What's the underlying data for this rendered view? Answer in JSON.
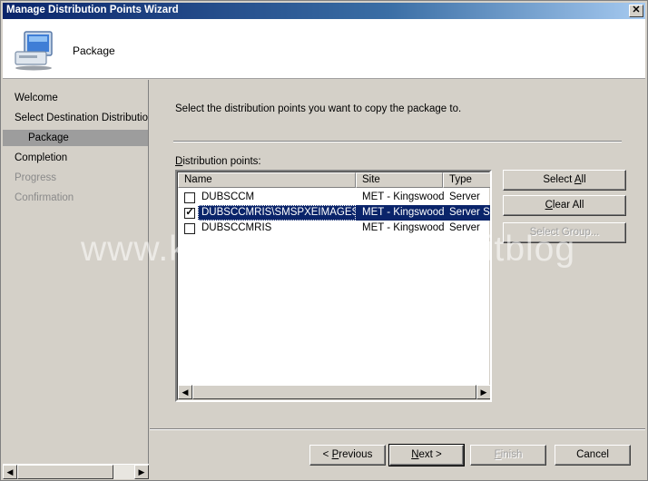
{
  "window": {
    "title": "Manage Distribution Points Wizard",
    "close_label": "✕"
  },
  "header": {
    "title": "Package",
    "icon": "computer-icon"
  },
  "sidebar": {
    "items": [
      {
        "label": "Welcome",
        "state": "normal"
      },
      {
        "label": "Select Destination Distribution P",
        "state": "normal"
      },
      {
        "label": "Package",
        "state": "active"
      },
      {
        "label": "Completion",
        "state": "normal"
      },
      {
        "label": "Progress",
        "state": "disabled"
      },
      {
        "label": "Confirmation",
        "state": "disabled"
      }
    ],
    "scroll_left": "◀",
    "scroll_right": "▶"
  },
  "main": {
    "instruction": "Select the distribution points you want to copy the package to.",
    "list_label_prefix": "D",
    "list_label_rest": "istribution points:",
    "columns": [
      "Name",
      "Site",
      "Type"
    ],
    "rows": [
      {
        "name": "DUBSCCM",
        "site": "MET - Kingswood",
        "type": "Server",
        "checked": false,
        "selected": false
      },
      {
        "name": "DUBSCCMRIS\\SMSPXEIMAGES$",
        "site": "MET - Kingswood",
        "type": "Server Sh",
        "checked": true,
        "selected": true
      },
      {
        "name": "DUBSCCMRIS",
        "site": "MET - Kingswood",
        "type": "Server",
        "checked": false,
        "selected": false
      }
    ],
    "check_mark": "✓",
    "scroll_left": "◀",
    "scroll_right": "▶"
  },
  "side_buttons": {
    "select_all_pre": "Select ",
    "select_all_key": "A",
    "select_all_post": "ll",
    "clear_all_key": "C",
    "clear_all_post": "lear All",
    "select_group": "Select Group..."
  },
  "footer": {
    "previous_pre": "< ",
    "previous_key": "P",
    "previous_post": "revious",
    "next_key": "N",
    "next_post": "ext >",
    "finish_key": "F",
    "finish_post": "inish",
    "cancel": "Cancel"
  },
  "watermark": "www.kozeniauskas.com/itblog",
  "colors": {
    "titlebar": "#0a246a",
    "selection": "#0a246a",
    "face": "#d4d0c8"
  }
}
